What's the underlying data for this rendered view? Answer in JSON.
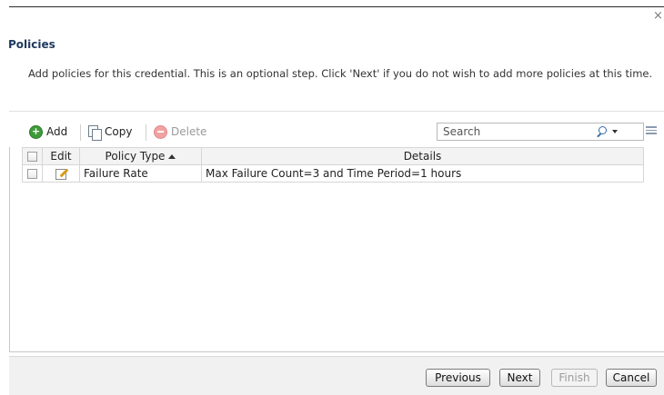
{
  "dialog": {
    "close_glyph": "×",
    "title": "Policies",
    "description": "Add policies for this credential. This is an optional step. Click 'Next' if you do not wish to add more policies at this time."
  },
  "toolbar": {
    "add_label": "Add",
    "copy_label": "Copy",
    "delete_label": "Delete",
    "search_placeholder": "Search",
    "add_icon": "plus-circle-icon",
    "copy_icon": "copy-pages-icon",
    "delete_icon": "minus-circle-icon",
    "search_icon": "magnifier-icon",
    "columns_icon": "column-chooser-icon"
  },
  "grid": {
    "columns": {
      "edit": "Edit",
      "policy_type": "Policy Type",
      "details": "Details"
    },
    "sort": {
      "column": "Policy Type",
      "direction": "ascending"
    },
    "rows": [
      {
        "policy_type": "Failure Rate",
        "details": "Max Failure Count=3 and Time Period=1 hours"
      }
    ]
  },
  "footer": {
    "previous": "Previous",
    "next": "Next",
    "finish": "Finish",
    "cancel": "Cancel"
  },
  "colors": {
    "title": "#1f3a60",
    "add_icon": "#3f9b3a",
    "delete_icon": "#f0a2a2"
  }
}
